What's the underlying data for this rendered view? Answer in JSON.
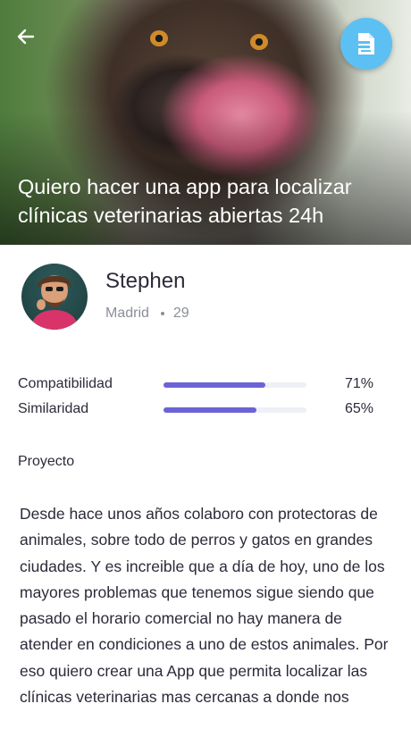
{
  "header": {
    "title": "Quiero hacer una app para localizar clínicas veterinarias abiertas 24h",
    "back_icon": "arrow-left-icon",
    "action_icon": "document-icon",
    "action_color": "#5cc0f2"
  },
  "user": {
    "name": "Stephen",
    "city": "Madrid",
    "age": "29"
  },
  "stats": [
    {
      "label": "Compatibilidad",
      "value": "71%",
      "fraction": 0.71
    },
    {
      "label": "Similaridad",
      "value": "65%",
      "fraction": 0.65
    }
  ],
  "colors": {
    "accent": "#6b63d6",
    "track": "#eef0f6"
  },
  "project": {
    "title": "Proyecto",
    "description": "Desde hace unos años colaboro con protectoras de animales, sobre todo de perros y gatos en grandes ciudades. Y es increible que a día de hoy, uno de los mayores problemas que tenemos sigue siendo que pasado el horario comercial no hay manera de atender en condiciones a uno de estos animales. Por eso quiero crear una App que permita localizar las clínicas veterinarias mas cercanas a donde nos"
  }
}
